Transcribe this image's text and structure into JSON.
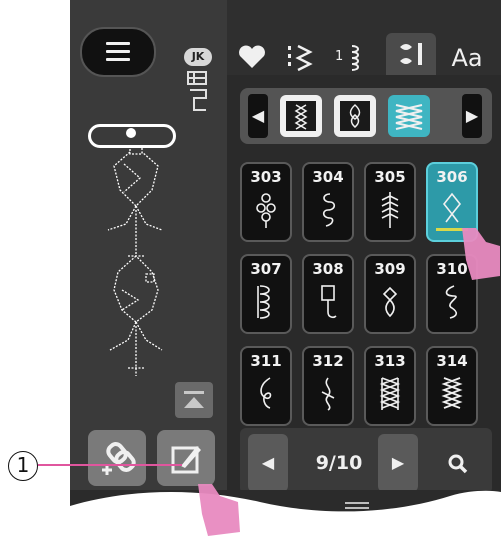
{
  "header": {
    "menu_icon": "hamburger-icon",
    "profile_badge": "JK",
    "tabs": [
      {
        "icon": "heart-icon",
        "label": ""
      },
      {
        "icon": "stitch-zigzag-icon",
        "label": ""
      },
      {
        "icon": "stitch-numbered-icon",
        "label": ""
      },
      {
        "icon": "decorative-stitch-icon",
        "label": "",
        "active": true
      },
      {
        "icon": "text-icon",
        "label": "Aa"
      }
    ]
  },
  "category_bar": {
    "categories": [
      {
        "icon": "cross-stitch-icon",
        "selected": false
      },
      {
        "icon": "leaf-stitch-icon",
        "selected": false
      },
      {
        "icon": "triangle-stitch-icon",
        "selected": true
      }
    ]
  },
  "stitches": [
    {
      "number": "303",
      "selected": false
    },
    {
      "number": "304",
      "selected": false
    },
    {
      "number": "305",
      "selected": false
    },
    {
      "number": "306",
      "selected": true
    },
    {
      "number": "307",
      "selected": false
    },
    {
      "number": "308",
      "selected": false
    },
    {
      "number": "309",
      "selected": false
    },
    {
      "number": "310",
      "selected": false
    },
    {
      "number": "311",
      "selected": false
    },
    {
      "number": "312",
      "selected": false
    },
    {
      "number": "313",
      "selected": false
    },
    {
      "number": "314",
      "selected": false
    }
  ],
  "pager": {
    "page": "9/10"
  },
  "callout": {
    "label": "1"
  },
  "colors": {
    "accent": "#3fb5c2",
    "pointer": "#e88ac0",
    "callout_line": "#e0569e"
  }
}
